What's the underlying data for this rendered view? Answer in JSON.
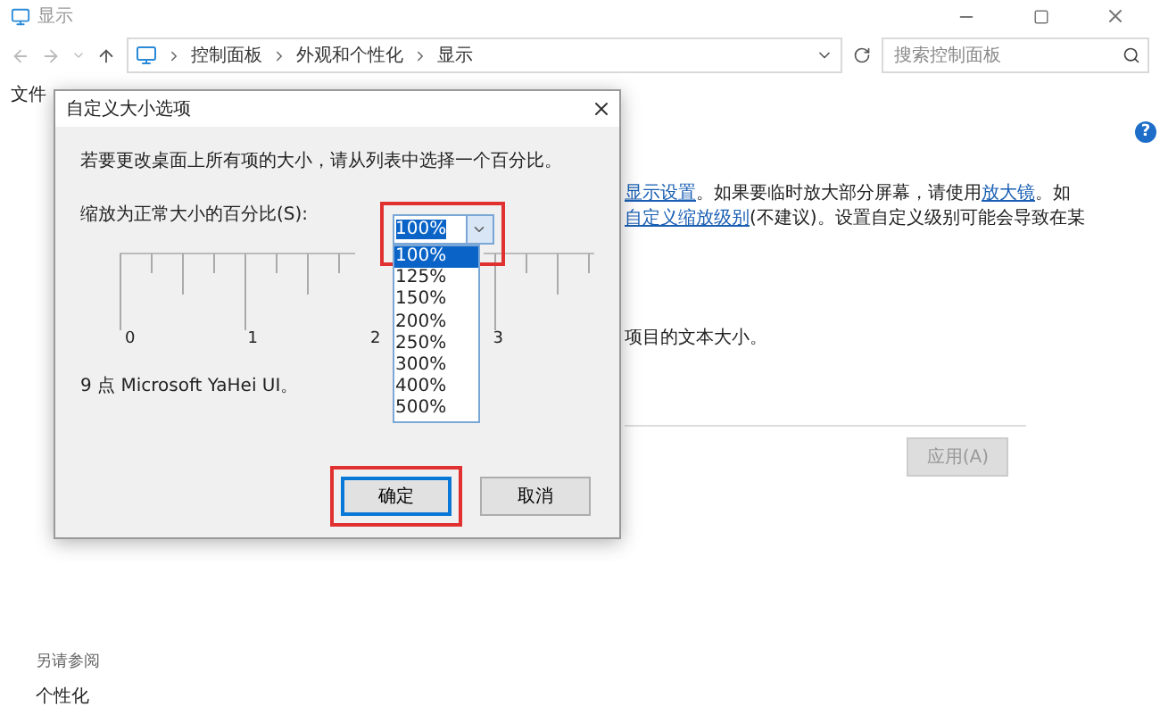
{
  "window": {
    "title": "显示"
  },
  "address_bar": {
    "breadcrumbs": [
      "控制面板",
      "外观和个性化",
      "显示"
    ]
  },
  "search": {
    "placeholder": "搜索控制面板"
  },
  "menu_bar": [
    "文件"
  ],
  "help": {
    "label": "?"
  },
  "content": {
    "lines": [
      [
        {
          "text": "显示设置",
          "link": true
        },
        {
          "text": "。如果要临时放大部分屏幕，请使用",
          "link": false
        },
        {
          "text": "放大镜",
          "link": true
        },
        {
          "text": "。如",
          "link": false
        }
      ],
      [
        {
          "text": "自定义缩放级别",
          "link": true
        },
        {
          "text": "(不建议)。设置自定义级别可能会导致在某",
          "link": false
        }
      ]
    ],
    "note": "项目的文本大小。"
  },
  "apply_button": {
    "label": "应用(A)",
    "disabled": true
  },
  "see_also": {
    "title": "另请参阅",
    "items": [
      "个性化"
    ]
  },
  "dialog": {
    "title": "自定义大小选项",
    "instruction": "若要更改桌面上所有项的大小，请从列表中选择一个百分比。",
    "scale_label": "缩放为正常大小的百分比(S):",
    "combo": {
      "value": "100%",
      "highlighted": true,
      "expanded": true
    },
    "options": [
      {
        "label": "100%",
        "selected": true
      },
      {
        "label": "125%",
        "selected": false
      },
      {
        "label": "150%",
        "selected": false
      },
      {
        "label": "200%",
        "selected": false
      },
      {
        "label": "250%",
        "selected": false
      },
      {
        "label": "300%",
        "selected": false
      },
      {
        "label": "400%",
        "selected": false
      },
      {
        "label": "500%",
        "selected": false
      }
    ],
    "ruler_labels": [
      "0",
      "1",
      "2",
      "3"
    ],
    "font_info": "9 点 Microsoft YaHei UI。",
    "buttons": [
      {
        "label": "确定",
        "focused": true,
        "highlighted": true
      },
      {
        "label": "取消",
        "focused": false,
        "highlighted": false
      }
    ]
  }
}
